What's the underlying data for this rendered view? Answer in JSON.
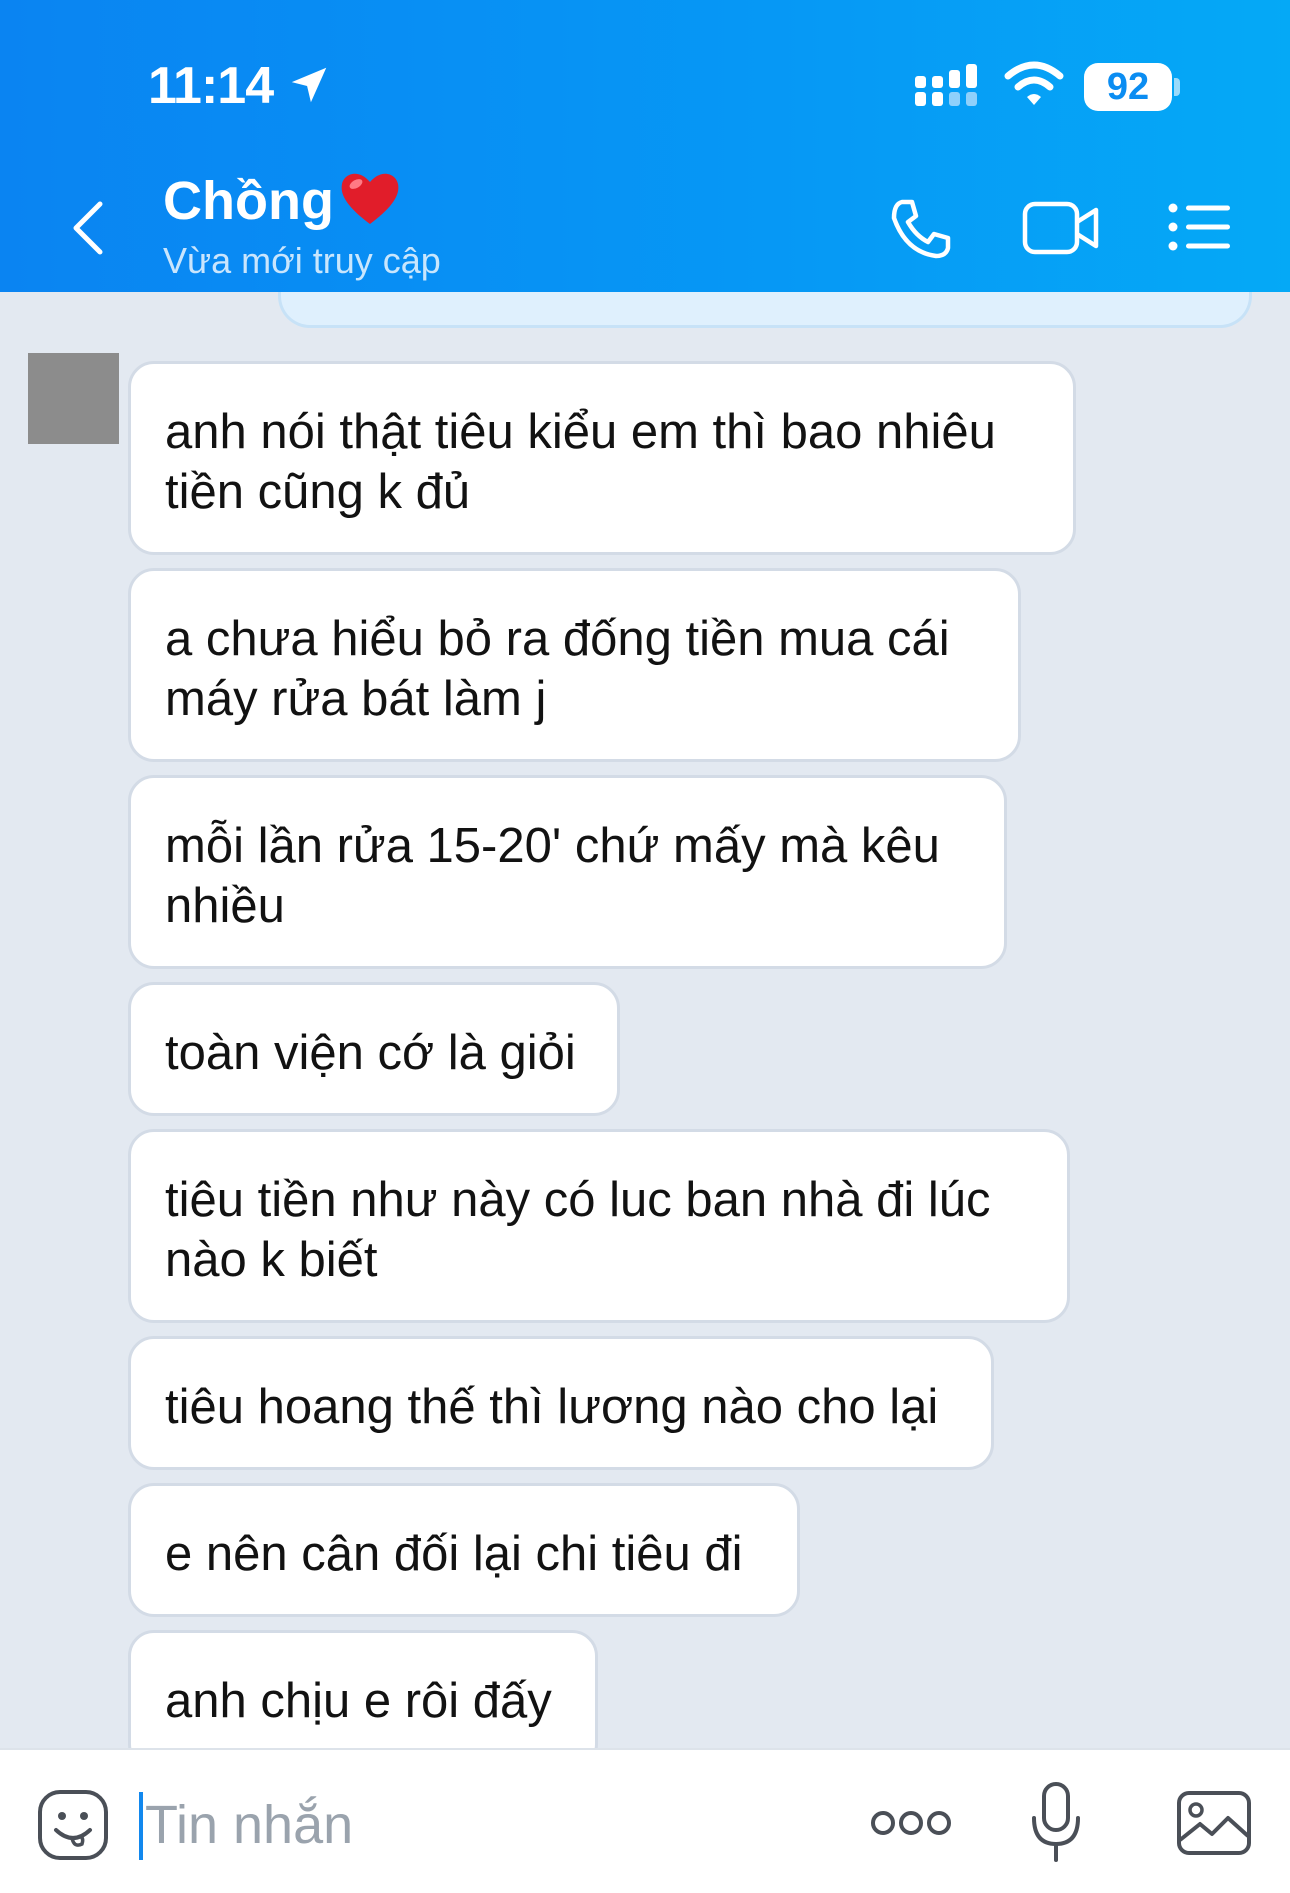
{
  "status_bar": {
    "time": "11:14",
    "battery": "92",
    "icons": [
      "location-arrow-icon",
      "signal-icon",
      "wifi-icon",
      "battery-icon"
    ]
  },
  "header": {
    "contact_name": "Chồng",
    "status": "Vừa mới truy cập",
    "icons": [
      "back-icon",
      "heart-icon",
      "call-icon",
      "video-call-icon",
      "menu-icon"
    ],
    "accent_color": "#0a8ef3"
  },
  "messages": [
    {
      "text": "anh nói thật tiêu kiểu em thì bao nhiêu tiền cũng k đủ"
    },
    {
      "text": "a chưa hiểu bỏ ra đống tiền mua cái máy rửa bát làm j"
    },
    {
      "text": "mỗi lần rửa 15-20' chứ mấy mà kêu nhiều"
    },
    {
      "text": "toàn viện cớ là giỏi"
    },
    {
      "text": "tiêu tiền như này có luc ban nhà đi lúc nào k biết"
    },
    {
      "text": "tiêu hoang thế thì lương nào cho lại"
    },
    {
      "text": "e nên cân đối lại chi tiêu đi"
    },
    {
      "text": "anh chịu e rôi đấy"
    }
  ],
  "input_bar": {
    "placeholder": "Tin nhắn",
    "value": "",
    "icons": [
      "sticker-icon",
      "more-icon",
      "microphone-icon",
      "image-icon"
    ]
  }
}
